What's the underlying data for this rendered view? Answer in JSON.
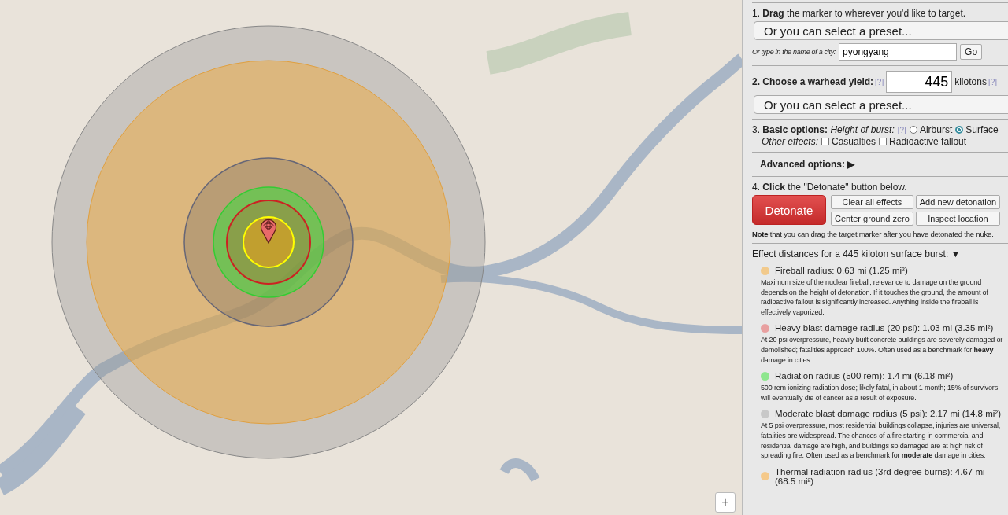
{
  "map": {
    "zoom_button": "+"
  },
  "panel": {
    "step1": {
      "text": "1. **Drag** the marker to wherever you'd like to target.",
      "preset": "Or you can select a preset...",
      "city_label": "Or type in the name of a city:",
      "city_value": "pyongyang",
      "go": "Go"
    },
    "step2": {
      "label": "2. Choose a warhead yield:",
      "help": "[?]",
      "yield_value": "445",
      "unit": "kilotons",
      "unit_help": "[?]",
      "preset": "Or you can select a preset..."
    },
    "step3": {
      "label": "3. **Basic options:** *Height of burst:*",
      "help": "[?]",
      "radios": [
        {
          "label": "Airburst",
          "selected": false
        },
        {
          "label": "Surface",
          "selected": true
        }
      ],
      "effects_label": "Other effects:",
      "checkboxes": [
        {
          "label": "Casualties",
          "checked": false
        },
        {
          "label": "Radioactive fallout",
          "checked": false
        }
      ]
    },
    "advanced": {
      "label": "Advanced options:",
      "toggle": "▶"
    },
    "step4": {
      "text": "4. **Click** the \"Detonate\" button below.",
      "detonate": "Detonate",
      "buttons": [
        "Clear all effects",
        "Add new detonation",
        "Center ground zero",
        "Inspect location"
      ],
      "note": "**Note** that you can drag the target marker after you have detonated the nuke."
    },
    "effects_header": {
      "text": "Effect distances for a 445 kiloton surface burst:",
      "toggle": "▼"
    },
    "effects": [
      {
        "color": "#f2ca8c",
        "title": "Fireball radius: 0.63 mi (1.25 mi²)",
        "description": "Maximum size of the nuclear fireball; relevance to damage on the ground depends on the height of detonation. If it touches the ground, the amount of radioactive fallout is significantly increased. Anything inside the fireball is effectively vaporized."
      },
      {
        "color": "#e8a0a0",
        "title": "Heavy blast damage radius (20 psi): 1.03 mi (3.35 mi²)",
        "description": "At 20 psi overpressure, heavily built concrete buildings are severely damaged or demolished; fatalities approach 100%. Often used as a benchmark for **heavy** damage in cities."
      },
      {
        "color": "#8ee68e",
        "title": "Radiation radius (500 rem): 1.4 mi (6.18 mi²)",
        "description": "500 rem ionizing radiation dose; likely fatal, in about 1 month; 15% of survivors will eventually die of cancer as a result of exposure."
      },
      {
        "color": "#c8c8c8",
        "title": "Moderate blast damage radius (5 psi): 2.17 mi (14.8 mi²)",
        "description": "At 5 psi overpressure, most residential buildings collapse, injuries are universal, fatalities are widespread. The chances of a fire starting in commercial and residential damage are high, and buildings so damaged are at high risk of spreading fire. Often used as a benchmark for **moderate** damage in cities."
      },
      {
        "color": "#f5c98a",
        "title": "Thermal radiation radius (3rd degree burns): 4.67 mi (68.5 mi²)"
      }
    ]
  }
}
